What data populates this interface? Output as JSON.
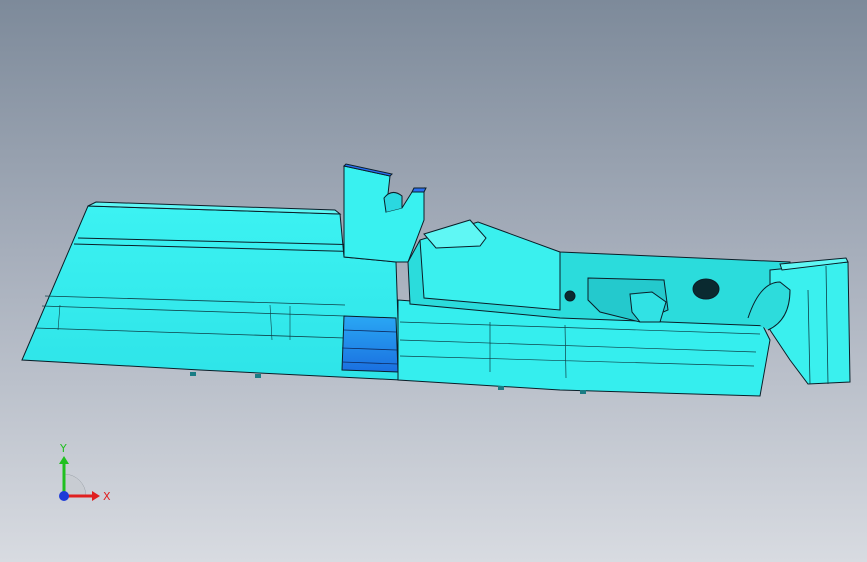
{
  "viewport": {
    "background_top": "#7d8a9a",
    "background_bottom": "#d8dbe1"
  },
  "model": {
    "face_color": "#37f0f0",
    "face_shade": "#2bd6da",
    "selected_face_color": "#1e90ee",
    "edge_color": "#0a1e28"
  },
  "triad": {
    "x_label": "X",
    "y_label": "Y",
    "x_color": "#e02020",
    "y_color": "#20c020",
    "z_color": "#1e3cd8"
  }
}
